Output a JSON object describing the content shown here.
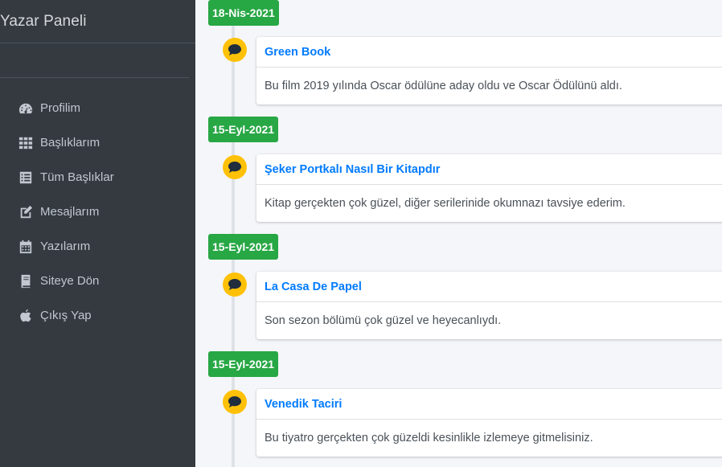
{
  "sidebar": {
    "brand": "Yazar Paneli",
    "items": [
      {
        "label": "Profilim",
        "icon": "tachometer-icon"
      },
      {
        "label": "Başlıklarım",
        "icon": "grid-icon"
      },
      {
        "label": "Tüm Başlıklar",
        "icon": "list-icon"
      },
      {
        "label": "Mesajlarım",
        "icon": "edit-icon"
      },
      {
        "label": "Yazılarım",
        "icon": "calendar-icon"
      },
      {
        "label": "Siteye Dön",
        "icon": "book-icon"
      },
      {
        "label": "Çıkış Yap",
        "icon": "apple-icon"
      }
    ]
  },
  "timeline": [
    {
      "date": "18-Nis-2021",
      "title": "Green Book",
      "body": "Bu film 2019 yılında Oscar ödülüne aday oldu ve Oscar Ödülünü aldı.",
      "icon": "comment-icon"
    },
    {
      "date": "15-Eyl-2021",
      "title": "Şeker Portkalı Nasıl Bir Kitapdır",
      "body": "Kitap gerçekten çok güzel, diğer serilerinide okumnazı tavsiye ederim.",
      "icon": "comment-icon"
    },
    {
      "date": "15-Eyl-2021",
      "title": "La Casa De Papel",
      "body": "Son sezon bölümü çok güzel ve heyecanlıydı.",
      "icon": "comment-icon"
    },
    {
      "date": "15-Eyl-2021",
      "title": "Venedik Taciri",
      "body": "Bu tiyatro gerçekten çok güzeldi kesinlikle izlemeye gitmelisiniz.",
      "icon": "comment-icon"
    }
  ],
  "colors": {
    "sidebar_bg": "#343a40",
    "date_label": "#28a745",
    "icon_bg": "#ffc107",
    "link": "#007bff"
  }
}
